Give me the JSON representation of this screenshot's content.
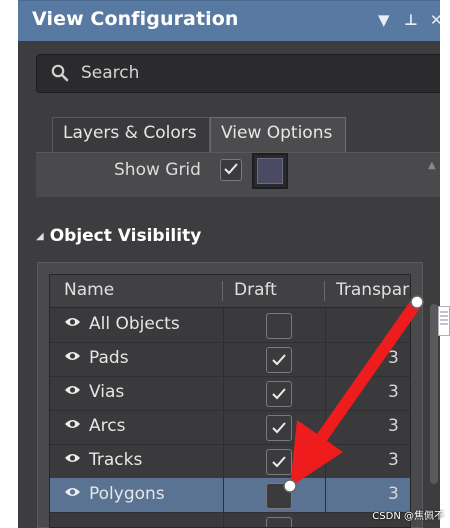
{
  "window": {
    "title": "View Configuration"
  },
  "search": {
    "placeholder": "Search"
  },
  "tabs": [
    {
      "label": "Layers & Colors",
      "active": false
    },
    {
      "label": "View Options",
      "active": true
    }
  ],
  "view_options": {
    "show_grid_label": "Show Grid",
    "show_grid_checked": true
  },
  "object_visibility": {
    "title": "Object Visibility",
    "columns": {
      "name": "Name",
      "draft": "Draft",
      "transparency": "Transpar"
    },
    "rows": [
      {
        "name": "All Objects",
        "draft": false,
        "transparency": ""
      },
      {
        "name": "Pads",
        "draft": true,
        "transparency": "3"
      },
      {
        "name": "Vias",
        "draft": true,
        "transparency": "3"
      },
      {
        "name": "Arcs",
        "draft": true,
        "transparency": "3"
      },
      {
        "name": "Tracks",
        "draft": true,
        "transparency": "3"
      },
      {
        "name": "Polygons",
        "draft": false,
        "transparency": "3",
        "selected": true
      }
    ]
  },
  "watermark": "CSDN @焦佩不",
  "colors": {
    "titlebar": "#5879a1",
    "panel": "#3d3d3f",
    "selected_row": "#5a7393",
    "annotation_arrow": "#ee1c1c"
  },
  "icons": [
    "search-icon",
    "pin-icon",
    "close-icon",
    "dropdown-triangle-icon",
    "eye-icon",
    "checkmark-icon",
    "collapse-triangle-icon"
  ]
}
